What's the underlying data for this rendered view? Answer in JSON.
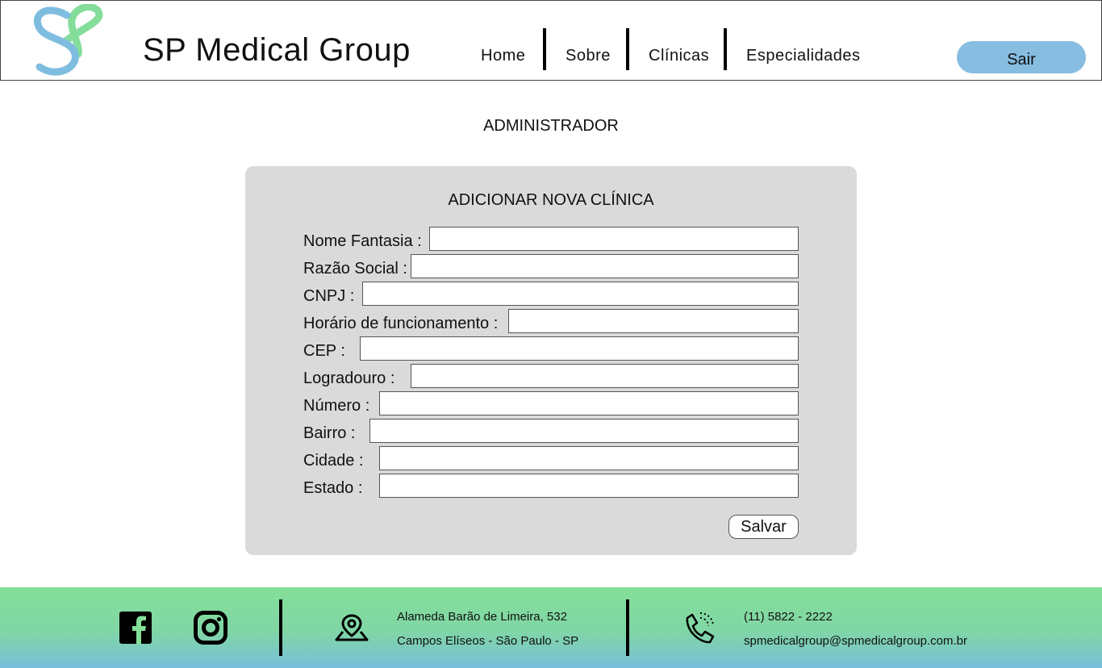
{
  "header": {
    "brand": "SP Medical Group",
    "nav": [
      "Home",
      "Sobre",
      "Clínicas",
      "Especialidades"
    ],
    "logout_label": "Sair",
    "logo_colors": {
      "left": "#7fbde0",
      "right": "#84dd9a"
    }
  },
  "page": {
    "role": "ADMINISTRADOR"
  },
  "form": {
    "title": "ADICIONAR NOVA CLÍNICA",
    "fields": [
      {
        "label": "Nome Fantasia :",
        "value": ""
      },
      {
        "label": "Razão Social :",
        "value": ""
      },
      {
        "label": "CNPJ :",
        "value": ""
      },
      {
        "label": "Horário de funcionamento :",
        "value": ""
      },
      {
        "label": "CEP :",
        "value": ""
      },
      {
        "label": "Logradouro :",
        "value": ""
      },
      {
        "label": "Número :",
        "value": ""
      },
      {
        "label": "Bairro :",
        "value": ""
      },
      {
        "label": "Cidade :",
        "value": ""
      },
      {
        "label": "Estado :",
        "value": ""
      }
    ],
    "save_label": "Salvar"
  },
  "footer": {
    "icons": [
      "facebook-icon",
      "instagram-icon",
      "map-pin-icon",
      "phone-icon"
    ],
    "address_line1": "Alameda Barão de Limeira, 532",
    "address_line2": "Campos Elíseos - São Paulo - SP",
    "phone": "(11) 5822 - 2222",
    "email": "spmedicalgroup@spmedicalgroup.com.br",
    "gradient": {
      "top": "#84df98",
      "bottom": "#78bfdc"
    }
  }
}
